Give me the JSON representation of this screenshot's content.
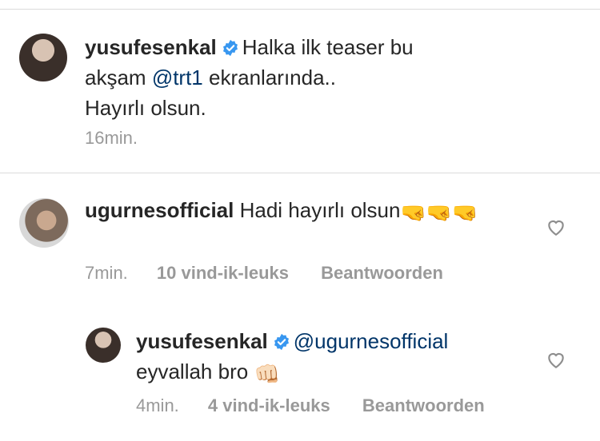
{
  "caption": {
    "username": "yusufesenkal",
    "text_line1": "Halka ilk teaser bu",
    "text_line2_prefix": "akşam",
    "mention": "@trt1",
    "text_line2_suffix": "ekranlarında..",
    "text_line3": "Hayırlı olsun.",
    "time": "16min."
  },
  "comment1": {
    "username": "ugurnesofficial",
    "text": "Hadi hayırlı olsun",
    "emoji": "🤜🤜🤜",
    "time": "7min.",
    "likes": "10 vind-ik-leuks",
    "reply": "Beantwoorden"
  },
  "reply1": {
    "username": "yusufesenkal",
    "mention": "@ugurnesofficial",
    "text": "eyvallah bro",
    "emoji": "👊🏻",
    "time": "4min.",
    "likes": "4 vind-ik-leuks",
    "reply": "Beantwoorden"
  },
  "colors": {
    "verified": "#3897f0",
    "mention": "#003569",
    "meta": "#999999"
  }
}
